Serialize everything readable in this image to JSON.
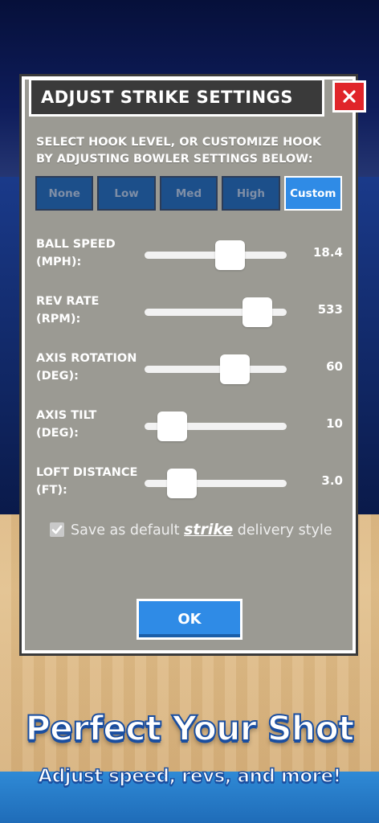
{
  "dialog": {
    "title": "ADJUST STRIKE SETTINGS",
    "instructions": "SELECT HOOK LEVEL, OR CUSTOMIZE HOOK BY ADJUSTING BOWLER SETTINGS BELOW:",
    "hook_levels": [
      "None",
      "Low",
      "Med",
      "High",
      "Custom"
    ],
    "selected_hook": "Custom",
    "settings": [
      {
        "label_line1": "BALL SPEED",
        "label_line2": "(MPH):",
        "value": "18.4",
        "level": 0.6
      },
      {
        "label_line1": "REV RATE",
        "label_line2": "(RPM):",
        "value": "533",
        "level": 0.79
      },
      {
        "label_line1": "AXIS ROTATION",
        "label_line2": "(DEG):",
        "value": "60",
        "level": 0.63
      },
      {
        "label_line1": "AXIS TILT",
        "label_line2": "(DEG):",
        "value": "10",
        "level": 0.19
      },
      {
        "label_line1": "LOFT DISTANCE",
        "label_line2": "(FT):",
        "value": "3.0",
        "level": 0.26
      }
    ],
    "checkbox": {
      "checked": true,
      "text_before": "Save as default",
      "text_emphasis": "strike",
      "text_after": "delivery style"
    },
    "ok_label": "OK"
  },
  "promo": {
    "title": "Perfect Your Shot",
    "subtitle": "Adjust speed, revs, and more!"
  },
  "colors": {
    "dialog_bg": "#9b9a93",
    "title_bar": "#3a3a3a",
    "close_red": "#e0252a",
    "button_blue": "#2f8be6",
    "hook_inactive": "#1c4f8a"
  },
  "icons": {
    "close": "close-icon",
    "check": "check-icon"
  }
}
